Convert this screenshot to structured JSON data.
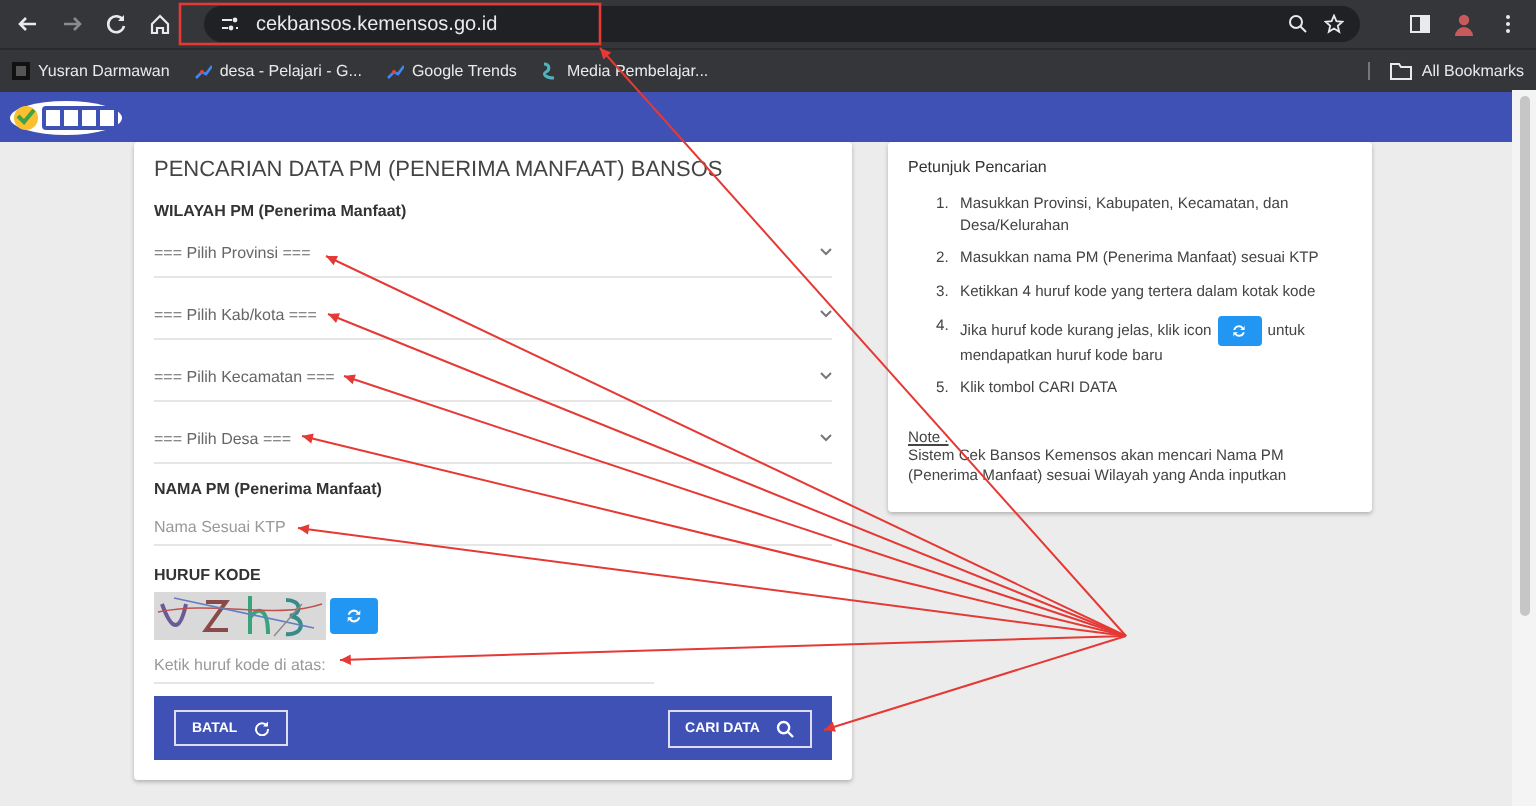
{
  "browser": {
    "url": "cekbansos.kemensos.go.id",
    "bookmarks": [
      {
        "label": "Yusran Darmawan"
      },
      {
        "label": "desa - Pelajari - G..."
      },
      {
        "label": "Google Trends"
      },
      {
        "label": "Media Pembelajar..."
      }
    ],
    "all_bookmarks": "All Bookmarks"
  },
  "form": {
    "title": "PENCARIAN DATA PM (PENERIMA MANFAAT) BANSOS",
    "region_heading": "WILAYAH PM (Penerima Manfaat)",
    "dropdowns": [
      {
        "label": "=== Pilih Provinsi ==="
      },
      {
        "label": "=== Pilih Kab/kota ==="
      },
      {
        "label": "=== Pilih Kecamatan ==="
      },
      {
        "label": "=== Pilih Desa ==="
      }
    ],
    "name_heading": "NAMA PM (Penerima Manfaat)",
    "name_field": {
      "placeholder": "Nama Sesuai KTP"
    },
    "code_heading": "HURUF KODE",
    "code_field": {
      "placeholder": "Ketik huruf kode di atas:"
    },
    "cancel_button": "BATAL",
    "search_button": "CARI DATA"
  },
  "guide": {
    "title": "Petunjuk Pencarian",
    "steps": [
      {
        "number": "1.",
        "text": "Masukkan Provinsi, Kabupaten, Kecamatan, dan Desa/Kelurahan"
      },
      {
        "number": "2.",
        "text": "Masukkan nama PM (Penerima Manfaat) sesuai KTP"
      },
      {
        "number": "3.",
        "text": "Ketikkan 4 huruf kode yang tertera dalam kotak kode"
      },
      {
        "number": "4.",
        "text": "Jika huruf kode kurang jelas, klik icon",
        "kind": "icon",
        "after": "untuk mendapatkan huruf kode baru"
      },
      {
        "number": "5.",
        "text": "Klik tombol CARI DATA"
      }
    ],
    "note_label": "Note :",
    "note": "Sistem Cek Bansos Kemensos akan mencari Nama PM (Penerima Manfaat) sesuai Wilayah yang Anda inputkan"
  }
}
